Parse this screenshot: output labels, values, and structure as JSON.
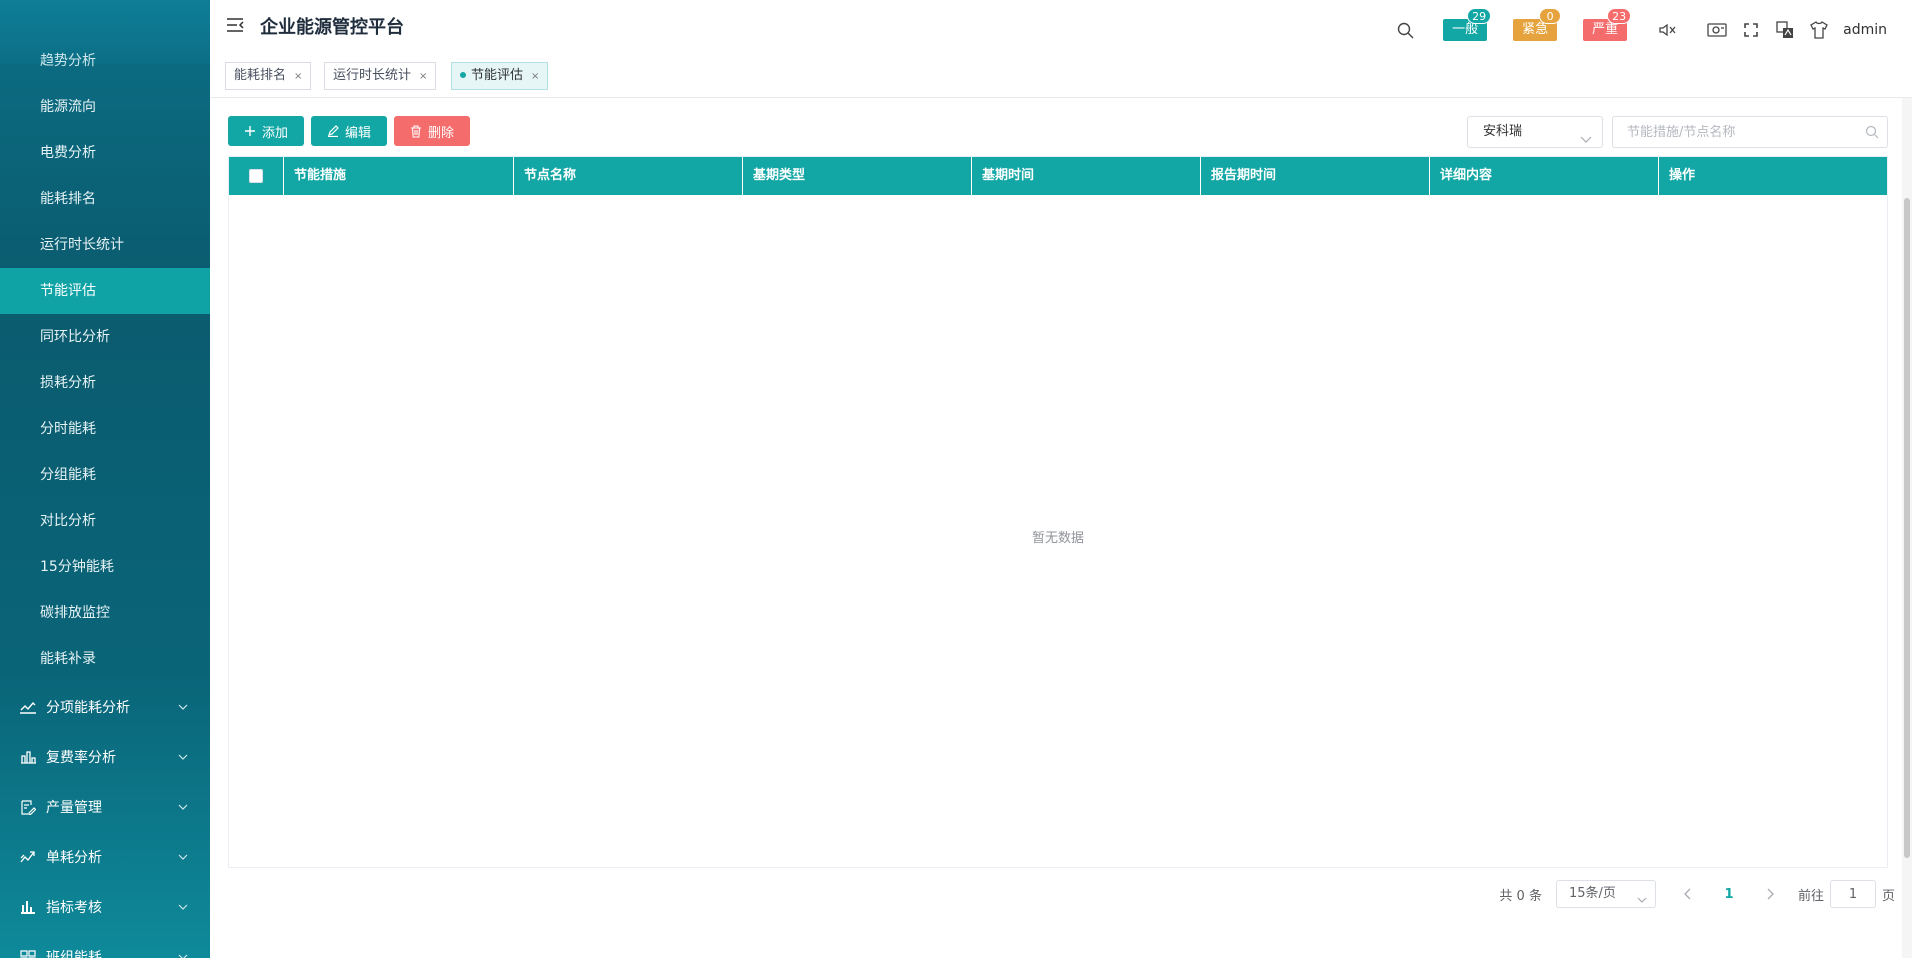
{
  "app": {
    "title": "企业能源管控平台"
  },
  "sidebar": {
    "cut_label": "趋势分析",
    "sub_items": [
      {
        "label": "能源流向"
      },
      {
        "label": "电费分析"
      },
      {
        "label": "能耗排名"
      },
      {
        "label": "运行时长统计"
      },
      {
        "label": "节能评估",
        "active": true
      },
      {
        "label": "同环比分析"
      },
      {
        "label": "损耗分析"
      },
      {
        "label": "分时能耗"
      },
      {
        "label": "分组能耗"
      },
      {
        "label": "对比分析"
      },
      {
        "label": "15分钟能耗"
      },
      {
        "label": "碳排放监控"
      },
      {
        "label": "能耗补录"
      }
    ],
    "groups": [
      {
        "label": "分项能耗分析",
        "icon": "trend-line-icon"
      },
      {
        "label": "复费率分析",
        "icon": "bar-chart-icon"
      },
      {
        "label": "产量管理",
        "icon": "edit-doc-icon"
      },
      {
        "label": "单耗分析",
        "icon": "zigzag-icon"
      },
      {
        "label": "指标考核",
        "icon": "column-chart-icon"
      },
      {
        "label": "班组能耗",
        "icon": "grid-icon"
      }
    ]
  },
  "header": {
    "alerts": [
      {
        "label": "一般",
        "count": "29",
        "color": "#12a7a5",
        "badge_color": "#12a7a5"
      },
      {
        "label": "紧急",
        "count": "0",
        "color": "#e6a23c",
        "badge_color": "#e6a23c"
      },
      {
        "label": "严重",
        "count": "23",
        "color": "#f56c6c",
        "badge_color": "#f56c6c"
      }
    ],
    "user": "admin"
  },
  "tags": [
    {
      "label": "能耗排名"
    },
    {
      "label": "运行时长统计"
    },
    {
      "label": "节能评估",
      "active": true
    }
  ],
  "toolbar": {
    "add_label": "添加",
    "edit_label": "编辑",
    "delete_label": "删除",
    "select_value": "安科瑞",
    "search_placeholder": "节能措施/节点名称"
  },
  "table": {
    "columns": [
      "节能措施",
      "节点名称",
      "基期类型",
      "基期时间",
      "报告期时间",
      "详细内容",
      "操作"
    ],
    "rows": [],
    "empty_text": "暂无数据"
  },
  "pagination": {
    "total_text": "共 0 条",
    "page_size": "15条/页",
    "current_page": "1",
    "goto_label": "前往",
    "goto_value": "1",
    "page_unit": "页"
  },
  "colors": {
    "accent": "#12a7a5",
    "danger": "#f56c6c",
    "warning": "#e6a23c",
    "sidebar": "#0b6f86"
  }
}
